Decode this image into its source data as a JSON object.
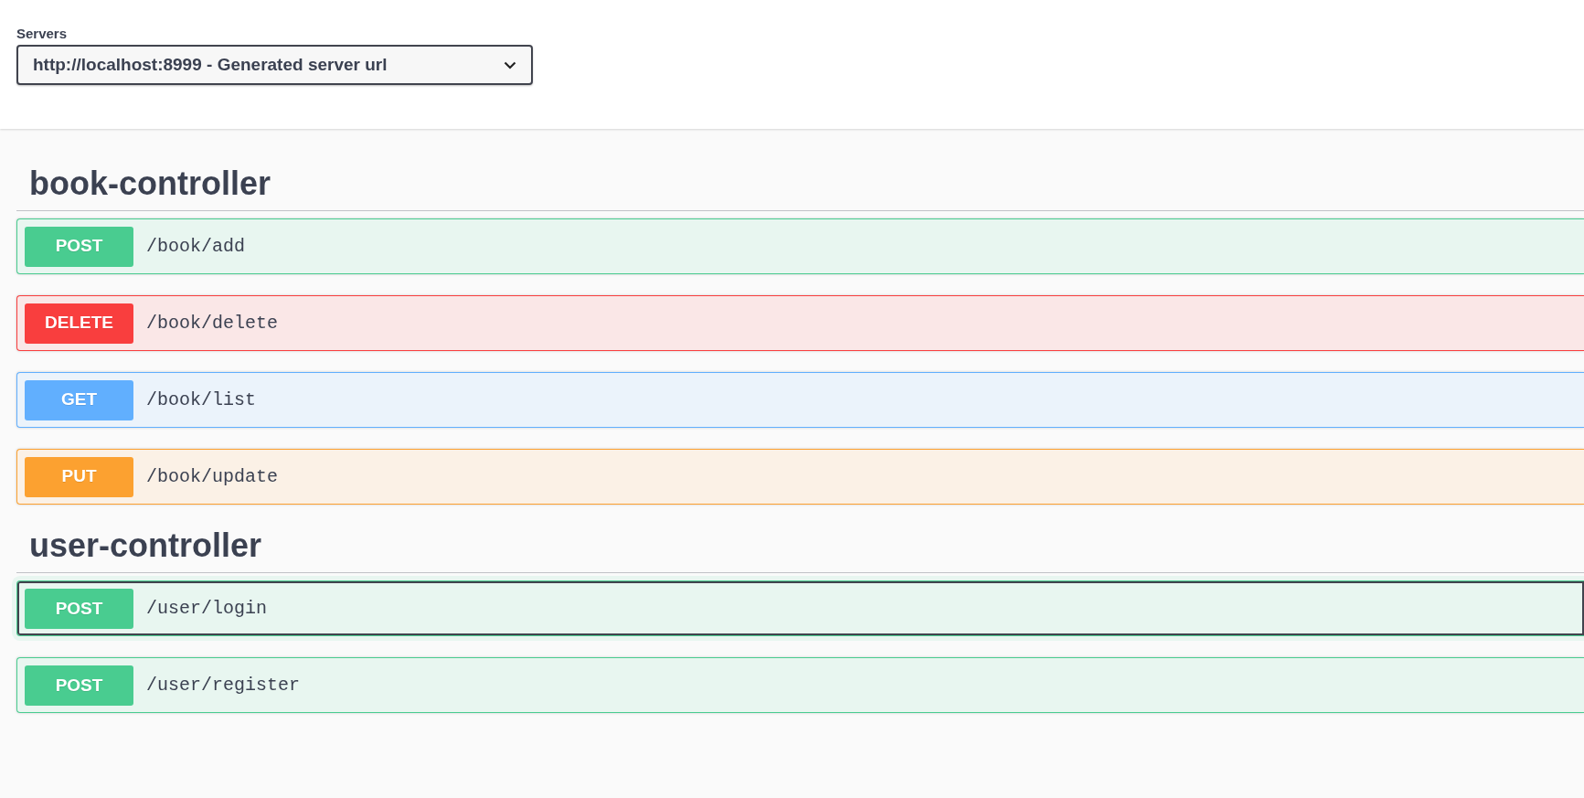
{
  "servers": {
    "label": "Servers",
    "value": "http://localhost:8999 - Generated server url"
  },
  "sections": [
    {
      "title": "book-controller",
      "operations": [
        {
          "kind": "post",
          "method": "POST",
          "path": "/book/add",
          "focused": false
        },
        {
          "kind": "delete",
          "method": "DELETE",
          "path": "/book/delete",
          "focused": false
        },
        {
          "kind": "get",
          "method": "GET",
          "path": "/book/list",
          "focused": false
        },
        {
          "kind": "put",
          "method": "PUT",
          "path": "/book/update",
          "focused": false
        }
      ]
    },
    {
      "title": "user-controller",
      "operations": [
        {
          "kind": "post",
          "method": "POST",
          "path": "/user/login",
          "focused": true
        },
        {
          "kind": "post",
          "method": "POST",
          "path": "/user/register",
          "focused": false
        }
      ]
    }
  ]
}
